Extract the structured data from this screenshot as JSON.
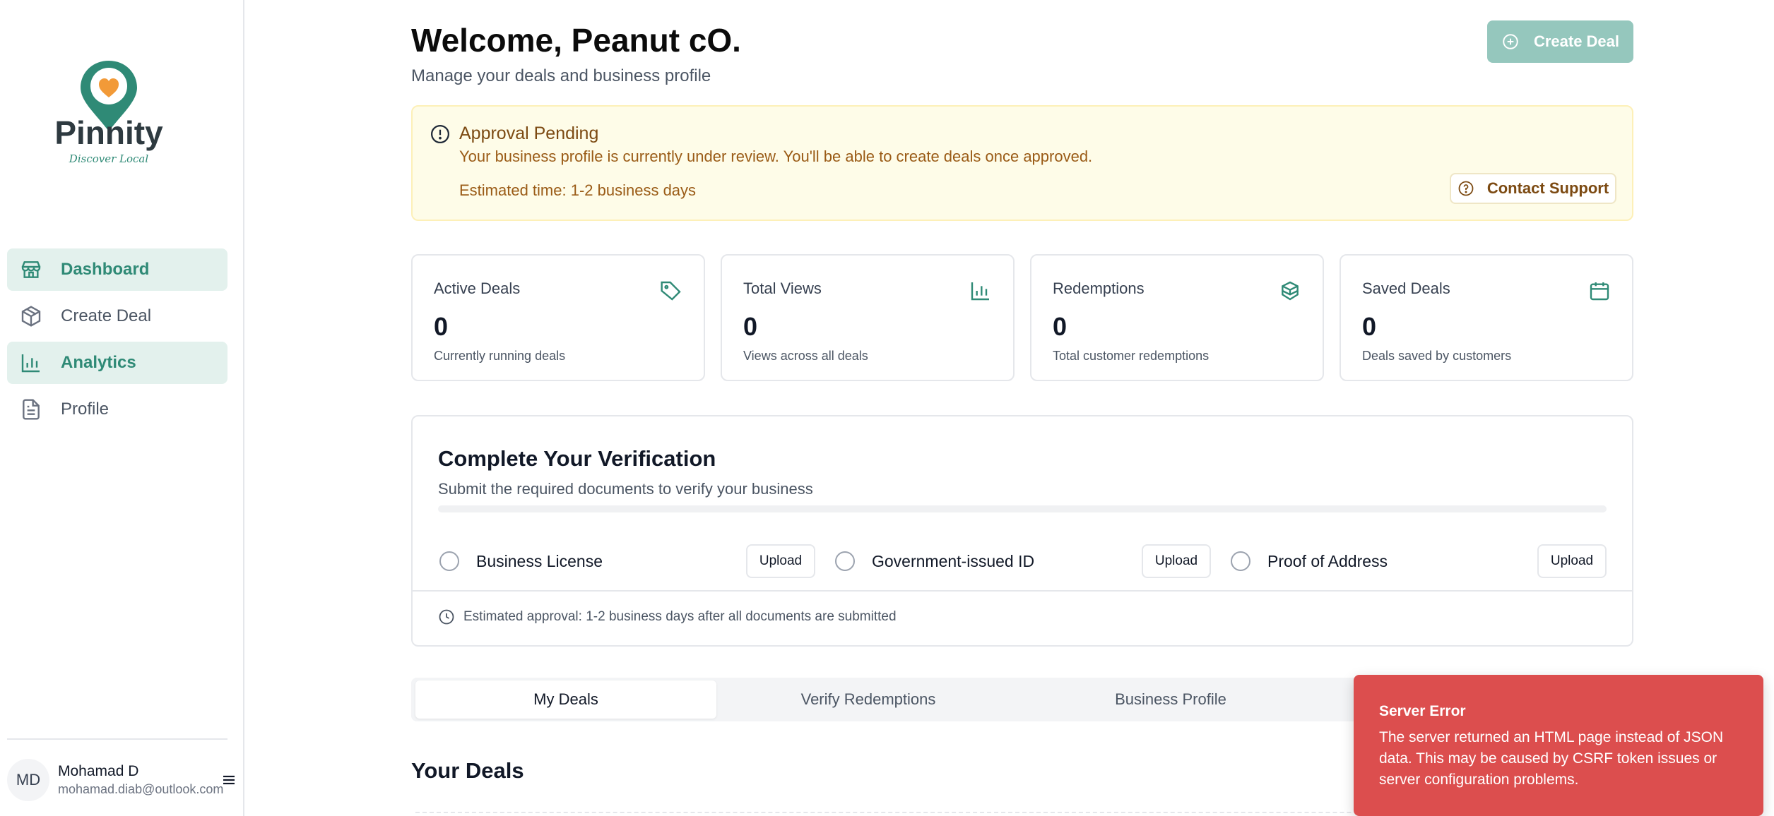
{
  "brand": {
    "name": "Pinnity",
    "tagline": "Discover Local",
    "primary_color": "#2f8a76",
    "accent_color": "#f29a38"
  },
  "sidebar": {
    "items": [
      {
        "label": "Dashboard",
        "icon": "store-icon",
        "active": true
      },
      {
        "label": "Create Deal",
        "icon": "box-icon",
        "active": false
      },
      {
        "label": "Analytics",
        "icon": "bar-chart-icon",
        "active": true
      },
      {
        "label": "Profile",
        "icon": "file-icon",
        "active": false
      }
    ],
    "user": {
      "initials": "MD",
      "name": "Mohamad D",
      "email": "mohamad.diab@outlook.com"
    }
  },
  "header": {
    "title": "Welcome, Peanut cO.",
    "subtitle": "Manage your deals and business profile",
    "create_label": "Create Deal"
  },
  "alert": {
    "title": "Approval Pending",
    "description": "Your business profile is currently under review. You'll be able to create deals once approved.",
    "estimate": "Estimated time: 1-2 business days",
    "support_label": "Contact Support",
    "bg_color": "#fefce8"
  },
  "stats": [
    {
      "label": "Active Deals",
      "value": "0",
      "sub": "Currently running deals",
      "icon": "tag-icon"
    },
    {
      "label": "Total Views",
      "value": "0",
      "sub": "Views across all deals",
      "icon": "bar-chart-icon"
    },
    {
      "label": "Redemptions",
      "value": "0",
      "sub": "Total customer redemptions",
      "icon": "package-icon"
    },
    {
      "label": "Saved Deals",
      "value": "0",
      "sub": "Deals saved by customers",
      "icon": "calendar-icon"
    }
  ],
  "verification": {
    "title": "Complete Your Verification",
    "subtitle": "Submit the required documents to verify your business",
    "progress": 0,
    "documents": [
      {
        "label": "Business License",
        "upload_label": "Upload"
      },
      {
        "label": "Government-issued ID",
        "upload_label": "Upload"
      },
      {
        "label": "Proof of Address",
        "upload_label": "Upload"
      }
    ],
    "footnote": "Estimated approval: 1-2 business days after all documents are submitted"
  },
  "tabs": [
    {
      "label": "My Deals",
      "active": true
    },
    {
      "label": "Verify Redemptions",
      "active": false
    },
    {
      "label": "Business Profile",
      "active": false
    }
  ],
  "deals_section": {
    "title": "Your Deals"
  },
  "toast": {
    "title": "Server Error",
    "message": "The server returned an HTML page instead of JSON data. This may be caused by CSRF token issues or server configuration problems.",
    "color": "#dc4e4e"
  }
}
